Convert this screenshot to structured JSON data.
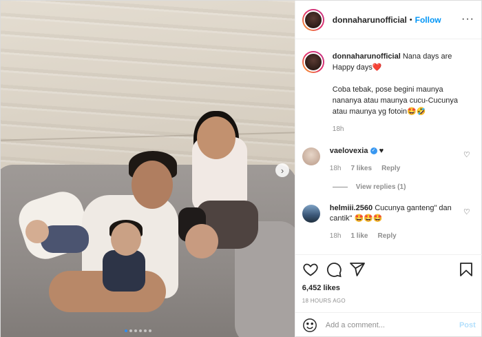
{
  "post": {
    "username": "donnaharunofficial",
    "follow_label": "Follow",
    "separator": "•",
    "more_icon": "more-horizontal-icon"
  },
  "caption": {
    "username": "donnaharunofficial",
    "line1": "Nana days are Happy days❤️",
    "line2": "Coba tebak, pose begini maunya nananya atau maunya cucu-Cucunya atau maunya yg fotoin🤩🤣",
    "time": "18h"
  },
  "comments": [
    {
      "username": "vaelovexia",
      "verified": true,
      "text": "♥",
      "time": "18h",
      "likes": "7 likes",
      "reply_label": "Reply",
      "view_replies": "View replies (1)"
    },
    {
      "username": "helmiii.2560",
      "text": "Cucunya ganteng\" dan cantik\" 🤩🤩🤩",
      "time": "18h",
      "likes": "1 like",
      "reply_label": "Reply"
    }
  ],
  "actions": {
    "likes": "6,452 likes",
    "timestamp": "18 HOURS AGO"
  },
  "add_comment": {
    "placeholder": "Add a comment...",
    "post_label": "Post"
  },
  "carousel": {
    "slides": 6,
    "active": 1
  },
  "colors": {
    "link": "#0095f6",
    "muted": "#8e8e8e",
    "post_disabled": "#b2dffc"
  }
}
